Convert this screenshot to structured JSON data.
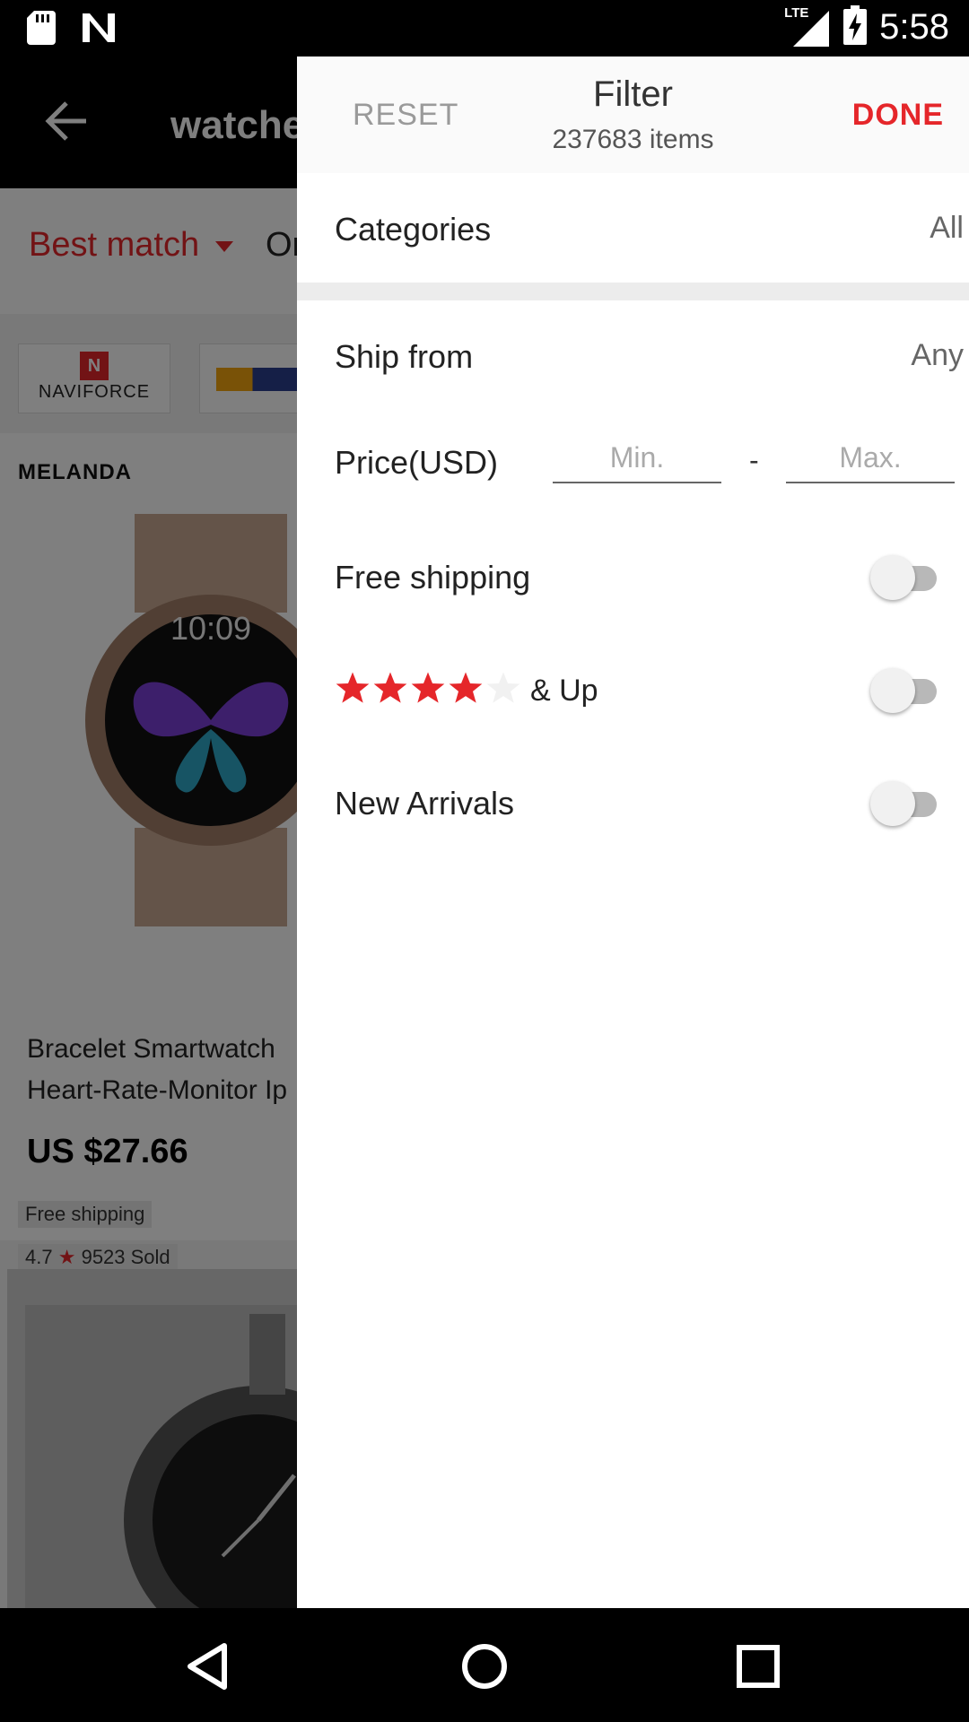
{
  "status_bar": {
    "time": "5:58",
    "network_label": "LTE",
    "icons": [
      "sd-card-icon",
      "n-icon",
      "lte-signal-icon",
      "battery-charging-icon"
    ]
  },
  "background_app": {
    "search_text": "watche",
    "sort": {
      "best_match": "Best match",
      "orders": "Or"
    },
    "brands": [
      "NAVIFORCE"
    ],
    "product_1": {
      "brand": "MELANDA",
      "title_line_1": "Bracelet Smartwatch",
      "title_line_2": "Heart-Rate-Monitor Ip",
      "price": "US $27.66",
      "shipping": "Free shipping",
      "rating": "4.7",
      "sold": "9523 Sold"
    }
  },
  "filter": {
    "reset_label": "RESET",
    "title": "Filter",
    "count": "237683 items",
    "done_label": "DONE",
    "categories_label": "Categories",
    "categories_value": "All",
    "ship_from_label": "Ship from",
    "ship_from_value": "Any",
    "price_label": "Price(USD)",
    "price_min_placeholder": "Min.",
    "price_max_placeholder": "Max.",
    "price_separator": "-",
    "free_shipping_label": "Free shipping",
    "free_shipping_on": false,
    "rating_label": "& Up",
    "rating_stars": 4,
    "rating_on": false,
    "new_arrivals_label": "New Arrivals",
    "new_arrivals_on": false
  },
  "colors": {
    "accent": "#e5262a",
    "toggle_off_track": "#b8b8b8",
    "toggle_off_knob": "#f1f1f1"
  },
  "nav_bar": {
    "icons": [
      "back-triangle-icon",
      "home-circle-icon",
      "recents-square-icon"
    ]
  }
}
